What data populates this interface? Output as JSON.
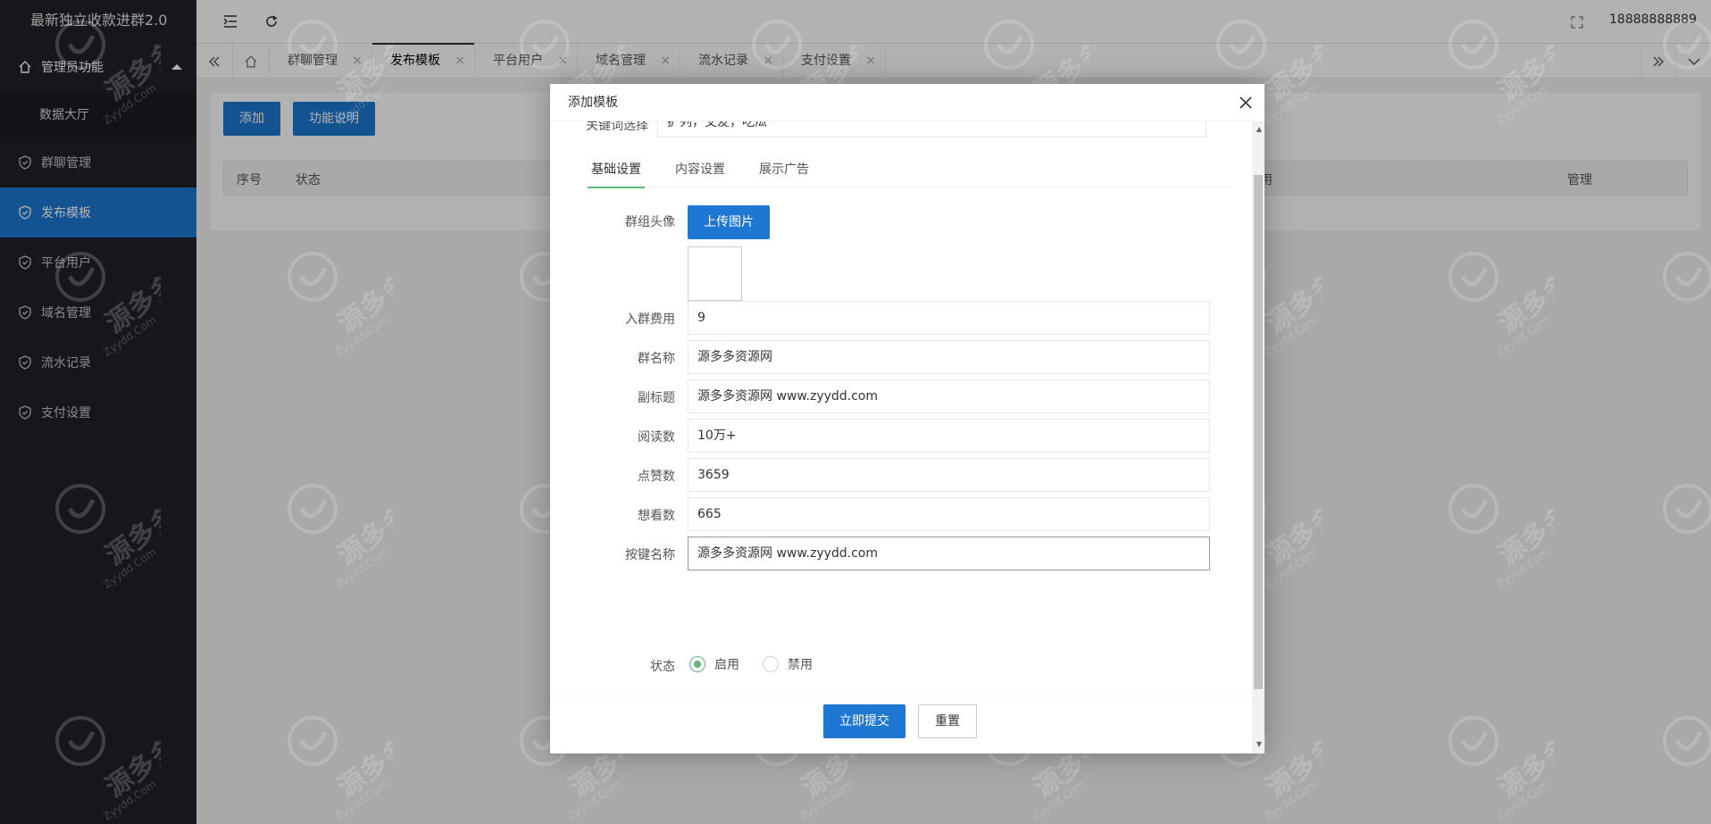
{
  "sidebar": {
    "logo": "最新独立收款进群2.0",
    "group": {
      "label": "管理员功能",
      "icon": "home-icon"
    },
    "sub_item": "数据大厅",
    "items": [
      {
        "label": "群聊管理",
        "icon": "shield-check-icon",
        "active": false
      },
      {
        "label": "发布模板",
        "icon": "shield-check-icon",
        "active": true
      },
      {
        "label": "平台用户",
        "icon": "shield-check-icon",
        "active": false
      },
      {
        "label": "域名管理",
        "icon": "shield-check-icon",
        "active": false
      },
      {
        "label": "流水记录",
        "icon": "shield-check-icon",
        "active": false
      },
      {
        "label": "支付设置",
        "icon": "shield-check-icon",
        "active": false
      }
    ],
    "colors": {
      "background": "#20222a",
      "active": "#1e77d2"
    }
  },
  "header": {
    "user": "18888888889",
    "icons": [
      "menu-fold-icon",
      "refresh-icon",
      "fullscreen-icon"
    ]
  },
  "tabs": {
    "items": [
      {
        "label": "群聊管理",
        "active": false
      },
      {
        "label": "发布模板",
        "active": true
      },
      {
        "label": "平台用户",
        "active": false
      },
      {
        "label": "域名管理",
        "active": false
      },
      {
        "label": "流水记录",
        "active": false
      },
      {
        "label": "支付设置",
        "active": false
      }
    ],
    "close_glyph": "×"
  },
  "page": {
    "add_button": "添加",
    "help_button": "功能说明",
    "table_headers": [
      "序号",
      "状态",
      "用",
      "管理"
    ]
  },
  "modal": {
    "title": "添加模板",
    "partial_field": {
      "label": "关键词选择",
      "value": "扩列，交友，吃瓜"
    },
    "form_tabs": [
      "基础设置",
      "内容设置",
      "展示广告"
    ],
    "avatar_label": "群组头像",
    "upload_button": "上传图片",
    "fields": [
      {
        "label": "入群费用",
        "value": "9"
      },
      {
        "label": "群名称",
        "value": "源多多资源网"
      },
      {
        "label": "副标题",
        "value": "源多多资源网 www.zyydd.com"
      },
      {
        "label": "阅读数",
        "value": "10万+"
      },
      {
        "label": "点赞数",
        "value": "3659"
      },
      {
        "label": "想看数",
        "value": "665"
      },
      {
        "label": "按键名称",
        "value": "源多多资源网 www.zyydd.com"
      }
    ],
    "status_label": "状态",
    "status_options": [
      {
        "label": "启用",
        "checked": true
      },
      {
        "label": "禁用",
        "checked": false
      }
    ],
    "submit_button": "立即提交",
    "reset_button": "重置",
    "accent": "#5fb878"
  },
  "watermark": {
    "text": "源多多",
    "subtext": "Zyydd.Com"
  }
}
